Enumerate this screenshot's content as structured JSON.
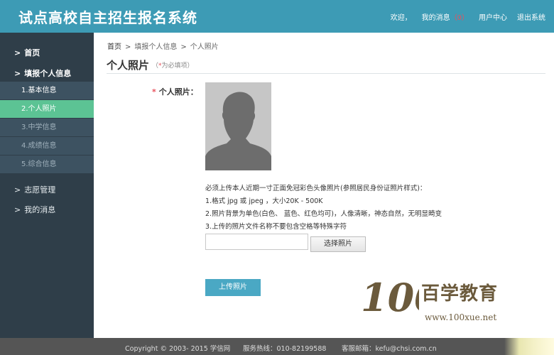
{
  "header": {
    "title": "试点高校自主招生报名系统",
    "welcome": "欢迎，",
    "messages_label": "我的消息",
    "messages_count": "（0）",
    "user_center": "用户中心",
    "logout": "退出系统"
  },
  "sidebar": {
    "arrow": ">",
    "home": "首页",
    "fill_info": "填报个人信息",
    "sub_items": [
      "1.基本信息",
      "2.个人照片",
      "3.中学信息",
      "4.成绩信息",
      "5.综合信息"
    ],
    "volunteer": "志愿管理",
    "my_messages": "我的消息"
  },
  "breadcrumb": {
    "home": "首页",
    "sep": ">",
    "level2": "填报个人信息",
    "current": "个人照片"
  },
  "page": {
    "title": "个人照片",
    "note_open": "（",
    "note_star": "*",
    "note_text": "为必填项）"
  },
  "form": {
    "star": "*",
    "label": "个人照片：",
    "instructions": [
      "必须上传本人近期一寸正面免冠彩色头像照片(参照居民身份证照片样式)：",
      "1.格式 jpg 或 jpeg ，大小20K - 500K",
      "2.照片背景为单色(白色、 蓝色、红色均可)，人像清晰，神态自然，无明显畸变",
      "3.上传的照片文件名称不要包含空格等特殊字符"
    ],
    "file_value": "",
    "choose_button": "选择照片",
    "upload_button": "上传照片"
  },
  "watermark": {
    "number": "100",
    "brand": "百学教育",
    "url": "www.100xue.net"
  },
  "footer": {
    "copyright": "Copyright © 2003- 2015 学信网",
    "hotline": "服务热线：010-82199588",
    "email": "客服邮箱：kefu@chsi.com.cn"
  },
  "colors": {
    "header": "#3d9bb5",
    "sidebar": "#2f3e49",
    "active": "#5cc394",
    "accent_red": "#e8505b",
    "upload_button": "#4aa8c4"
  }
}
